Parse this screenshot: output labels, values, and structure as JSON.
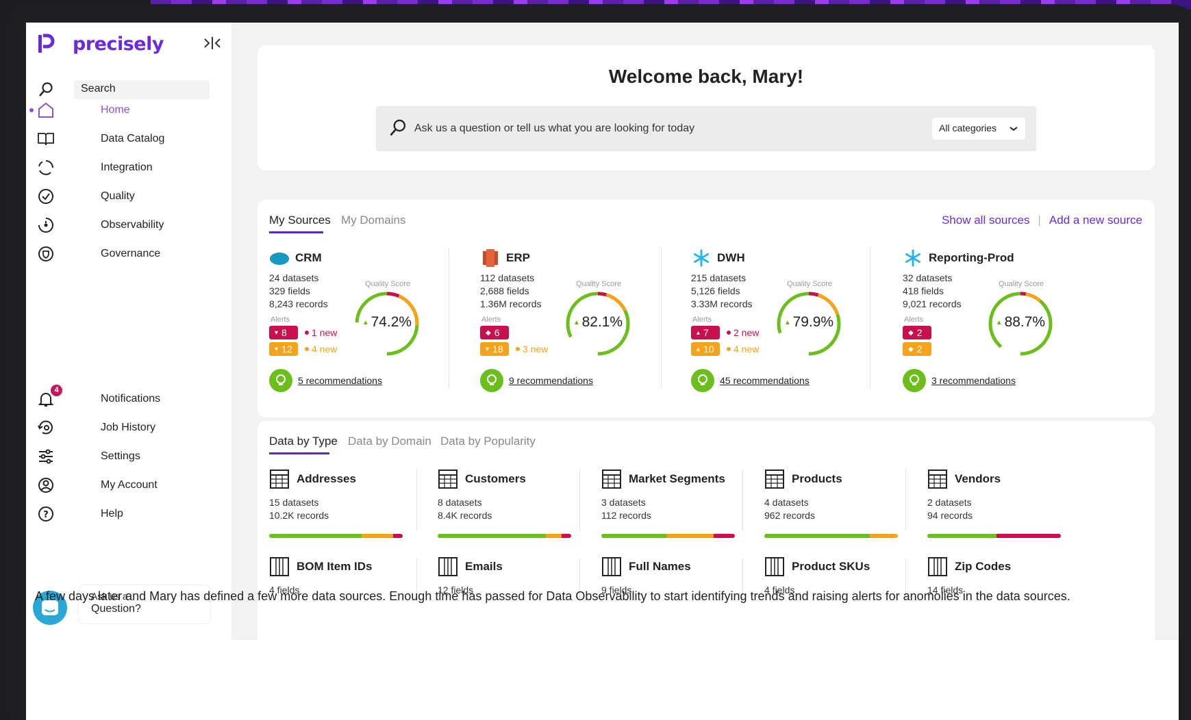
{
  "brand": {
    "name": "precisely",
    "color": "#6a2bd9"
  },
  "sidebar": {
    "search_label": "Search",
    "items": [
      {
        "label": "Home",
        "icon": "home-icon",
        "active": true
      },
      {
        "label": "Data Catalog",
        "icon": "book-icon"
      },
      {
        "label": "Integration",
        "icon": "integration-icon"
      },
      {
        "label": "Quality",
        "icon": "quality-check-icon"
      },
      {
        "label": "Observability",
        "icon": "observability-icon"
      },
      {
        "label": "Governance",
        "icon": "governance-shield-icon"
      }
    ],
    "bottom_items": [
      {
        "label": "Notifications",
        "icon": "bell-icon",
        "badge": "4"
      },
      {
        "label": "Job History",
        "icon": "job-history-icon"
      },
      {
        "label": "Settings",
        "icon": "sliders-icon"
      },
      {
        "label": "My Account",
        "icon": "user-circle-icon"
      },
      {
        "label": "Help",
        "icon": "help-icon"
      }
    ],
    "ask": {
      "line1": "Ask us a",
      "line2": "Question?"
    }
  },
  "welcome": {
    "title": "Welcome back, Mary!",
    "search_placeholder": "Ask us a question or tell us what you are looking for today",
    "category": "All categories"
  },
  "sources": {
    "tabs": [
      "My Sources",
      "My Domains"
    ],
    "show_all": "Show all sources",
    "separator": "|",
    "add_new": "Add a new source",
    "quality_label": "Quality Score",
    "alerts_label": "Alerts",
    "items": [
      {
        "name": "CRM",
        "logo": "salesforce-logo",
        "datasets": "24 datasets",
        "fields": "329 fields",
        "records": "8,243 records",
        "alert1": {
          "count": "8",
          "dir": "down",
          "new": "1 new"
        },
        "alert2": {
          "count": "12",
          "dir": "down",
          "new": "4 new"
        },
        "score": "74.2%",
        "score_value": 74.2,
        "recs": "5 recommendations"
      },
      {
        "name": "ERP",
        "logo": "erp-logo",
        "datasets": "112 datasets",
        "fields": "2,688 fields",
        "records": "1.36M records",
        "alert1": {
          "count": "6",
          "dir": "diamond",
          "new": ""
        },
        "alert2": {
          "count": "18",
          "dir": "down",
          "new": "3 new"
        },
        "score": "82.1%",
        "score_value": 82.1,
        "recs": "9 recommendations"
      },
      {
        "name": "DWH",
        "logo": "snowflake-logo",
        "datasets": "215 datasets",
        "fields": "5,126 fields",
        "records": "3.33M records",
        "alert1": {
          "count": "7",
          "dir": "up",
          "new": "2 new"
        },
        "alert2": {
          "count": "10",
          "dir": "up",
          "new": "4 new"
        },
        "score": "79.9%",
        "score_value": 79.9,
        "recs": "45 recommendations"
      },
      {
        "name": "Reporting-Prod",
        "logo": "snowflake-logo",
        "datasets": "32 datasets",
        "fields": "418 fields",
        "records": "9,021 records",
        "alert1": {
          "count": "2",
          "dir": "diamond",
          "new": ""
        },
        "alert2": {
          "count": "2",
          "dir": "diamond",
          "new": ""
        },
        "score": "88.7%",
        "score_value": 88.7,
        "recs": "3 recommendations"
      }
    ]
  },
  "types": {
    "tabs": [
      "Data by Type",
      "Data by Domain",
      "Data by Popularity"
    ],
    "row1": [
      {
        "name": "Addresses",
        "l1": "15 datasets",
        "l2": "10.2K records",
        "bar": [
          0.69,
          0.24,
          0.07
        ]
      },
      {
        "name": "Customers",
        "l1": "8 datasets",
        "l2": "8.4K records",
        "bar": [
          0.81,
          0.12,
          0.07
        ]
      },
      {
        "name": "Market Segments",
        "l1": "3 datasets",
        "l2": "112 records",
        "bar": [
          0.49,
          0.35,
          0.16
        ]
      },
      {
        "name": "Products",
        "l1": "4 datasets",
        "l2": "962 records",
        "bar": [
          0.79,
          0.21,
          0.0
        ]
      },
      {
        "name": "Vendors",
        "l1": "2 datasets",
        "l2": "94 records",
        "bar": [
          0.52,
          0.0,
          0.48
        ]
      }
    ],
    "row2": [
      {
        "name": "BOM Item IDs",
        "l1": "4 fields"
      },
      {
        "name": "Emails",
        "l1": "12 fields"
      },
      {
        "name": "Full Names",
        "l1": "9 fields"
      },
      {
        "name": "Product SKUs",
        "l1": "4 fields"
      },
      {
        "name": "Zip Codes",
        "l1": "14 fields"
      }
    ]
  },
  "colors": {
    "good": "#6bbe1c",
    "warn": "#f6a31b",
    "bad": "#c8104e"
  },
  "caption": "A few days later and Mary has defined a few more data sources. Enough time has passed for Data Observability to start identifying trends and raising alerts for anomolies in the data sources."
}
